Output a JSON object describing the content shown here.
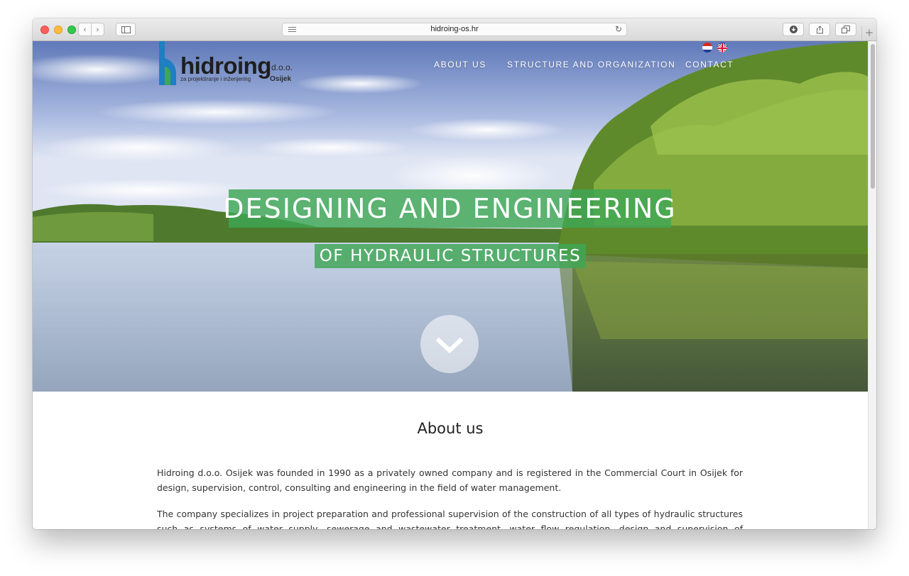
{
  "browser": {
    "url": "hidroing-os.hr"
  },
  "logo": {
    "name": "hidroing",
    "suffix": "d.o.o.",
    "tagline": "za projektiranje i inženjering",
    "city": "Osijek"
  },
  "nav": {
    "items": [
      "ABOUT US",
      "STRUCTURE AND ORGANIZATION",
      "CONTACT"
    ],
    "languages": [
      "croatian-flag-icon",
      "uk-flag-icon"
    ]
  },
  "hero": {
    "line1": "DESIGNING AND ENGINEERING",
    "line2": "OF HYDRAULIC STRUCTURES",
    "accent": "#3ea654"
  },
  "about": {
    "title": "About us",
    "p1": "Hidroing d.o.o. Osijek was founded in 1990 as a privately owned company and is registered in the Commercial Court in Osijek for design, supervision, control, consulting and engineering in the field of water management.",
    "p2": "The company specializes in project preparation and professional supervision of the construction of all types of hydraulic structures such as systems of water supply, sewerage and wastewater treatment, water flow regulation, design and supervision of construction of the port in river traffic, as well as"
  }
}
